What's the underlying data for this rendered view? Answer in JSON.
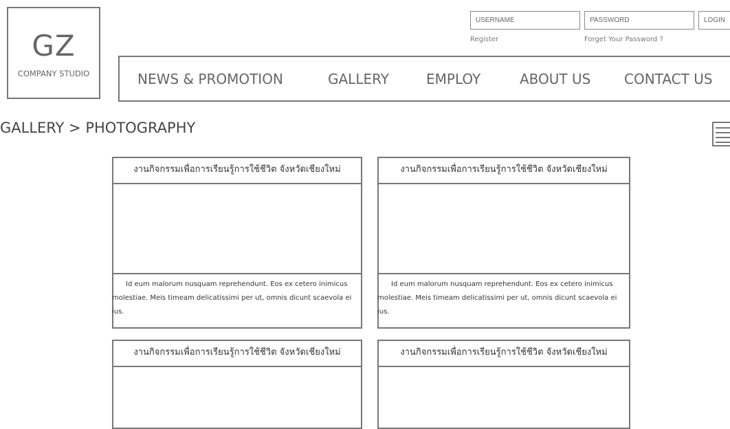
{
  "logo": {
    "main": "GZ",
    "sub": "COMPANY STUDIO"
  },
  "auth": {
    "username_placeholder": "USERNAME",
    "password_placeholder": "PASSWORD",
    "login_label": "LOGIN",
    "register_label": "Register",
    "forgot_label": "Forget Your Password ?"
  },
  "nav": {
    "items": [
      "NEWS & PROMOTION",
      "GALLERY",
      "EMPLOY",
      "ABOUT US",
      "CONTACT US"
    ]
  },
  "page": {
    "title": "GALLERY > PHOTOGRAPHY"
  },
  "icons": {
    "menu": "hamburger-menu-icon"
  },
  "gallery": {
    "cards": [
      {
        "title": "งานกิจกรรมเพื่อการเรียนรู้การใช้ชีวิต จังหวัดเชียงใหม่",
        "description": "Id eum malorum nusquam reprehendunt. Eos ex cetero inimicus molestiae. Meis timeam delicatissimi per ut, omnis dicunt scaevola ei ius."
      },
      {
        "title": "งานกิจกรรมเพื่อการเรียนรู้การใช้ชีวิต จังหวัดเชียงใหม่",
        "description": "Id eum malorum nusquam reprehendunt. Eos ex cetero inimicus molestiae. Meis timeam delicatissimi per ut, omnis dicunt scaevola ei ius."
      },
      {
        "title": "งานกิจกรรมเพื่อการเรียนรู้การใช้ชีวิต จังหวัดเชียงใหม่"
      },
      {
        "title": "งานกิจกรรมเพื่อการเรียนรู้การใช้ชีวิต จังหวัดเชียงใหม่"
      }
    ]
  }
}
